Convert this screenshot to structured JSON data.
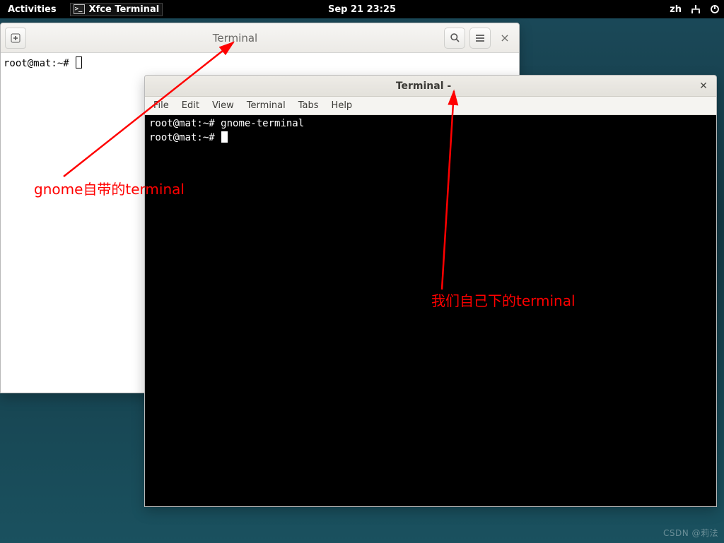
{
  "panel": {
    "activities": "Activities",
    "app_name": "Xfce Terminal",
    "clock": "Sep 21  23:25",
    "input_method": "zh"
  },
  "gnome_terminal": {
    "title": "Terminal",
    "prompt": "root@mat:~#"
  },
  "xfce_terminal": {
    "title": "Terminal -",
    "menu": {
      "file": "File",
      "edit": "Edit",
      "view": "View",
      "terminal": "Terminal",
      "tabs": "Tabs",
      "help": "Help"
    },
    "line1_prompt": "root@mat:~#",
    "line1_cmd": "gnome-terminal",
    "line2_prompt": "root@mat:~#"
  },
  "annotations": {
    "gnome_label": "gnome自带的terminal",
    "xfce_label": "我们自己下的terminal"
  },
  "watermark": "CSDN @莉法"
}
